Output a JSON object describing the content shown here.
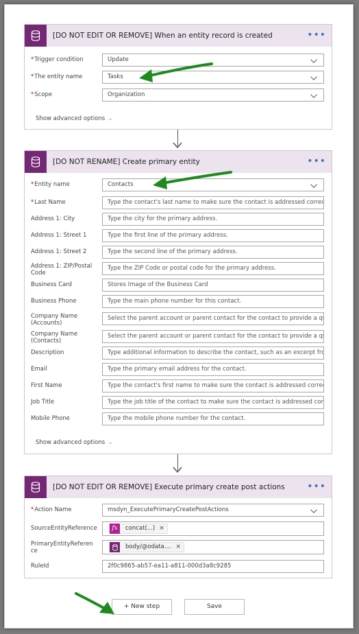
{
  "trigger_card": {
    "title": "[DO NOT EDIT OR REMOVE] When an entity record is created",
    "more_label": "•••",
    "fields": [
      {
        "label": "Trigger condition",
        "required": true,
        "value": "Update"
      },
      {
        "label": "The entity name",
        "required": true,
        "value": "Tasks"
      },
      {
        "label": "Scope",
        "required": true,
        "value": "Organization"
      }
    ],
    "advanced_label": "Show advanced options"
  },
  "create_card": {
    "title": "[DO NOT RENAME] Create primary entity",
    "more_label": "•••",
    "entity_name": {
      "label": "Entity name",
      "required": true,
      "value": "Contacts"
    },
    "fields": [
      {
        "label": "Last Name",
        "required": true,
        "placeholder": "Type the contact's last name to make sure the contact is addressed correctly i"
      },
      {
        "label": "Address 1: City",
        "required": false,
        "placeholder": "Type the city for the primary address."
      },
      {
        "label": "Address 1: Street 1",
        "required": false,
        "placeholder": "Type the first line of the primary address."
      },
      {
        "label": "Address 1: Street 2",
        "required": false,
        "placeholder": "Type the second line of the primary address."
      },
      {
        "label": "Address 1: ZIP/Postal Code",
        "required": false,
        "placeholder": "Type the ZIP Code or postal code for the primary address."
      },
      {
        "label": "Business Card",
        "required": false,
        "placeholder": "Stores Image of the Business Card"
      },
      {
        "label": "Business Phone",
        "required": false,
        "placeholder": "Type the main phone number for this contact."
      },
      {
        "label": "Company Name (Accounts)",
        "required": false,
        "placeholder": "Select the parent account or parent contact for the contact to provide a quick"
      },
      {
        "label": "Company Name (Contacts)",
        "required": false,
        "placeholder": "Select the parent account or parent contact for the contact to provide a quick"
      },
      {
        "label": "Description",
        "required": false,
        "placeholder": "Type additional information to describe the contact, such as an excerpt from t"
      },
      {
        "label": "Email",
        "required": false,
        "placeholder": "Type the primary email address for the contact."
      },
      {
        "label": "First Name",
        "required": false,
        "placeholder": "Type the contact's first name to make sure the contact is addressed correctly i"
      },
      {
        "label": "Job Title",
        "required": false,
        "placeholder": "Type the job title of the contact to make sure the contact is addressed correct"
      },
      {
        "label": "Mobile Phone",
        "required": false,
        "placeholder": "Type the mobile phone number for the contact."
      }
    ],
    "advanced_label": "Show advanced options"
  },
  "post_card": {
    "title": "[DO NOT EDIT OR REMOVE] Execute primary create post actions",
    "more_label": "•••",
    "action_name": {
      "label": "Action Name",
      "required": true,
      "value": "msdyn_ExecutePrimaryCreatePostActions"
    },
    "source_ref": {
      "label": "SourceEntityReference",
      "token_text": "concat(...)",
      "token_icon": "fx"
    },
    "primary_ref": {
      "label": "PrimaryEntityReference",
      "token_text": "body/@odata....",
      "token_icon": "database-icon"
    },
    "rule_id": {
      "label": "RuleId",
      "value": "2f0c9865-ab57-ea11-a811-000d3a8c9285"
    }
  },
  "footer": {
    "new_step_label": "+ New step",
    "save_label": "Save"
  },
  "colors": {
    "header_bg": "#ece3ef",
    "icon_bg": "#742774",
    "annotation_arrow": "#1e8a1e",
    "required_star": "#cc0000"
  }
}
